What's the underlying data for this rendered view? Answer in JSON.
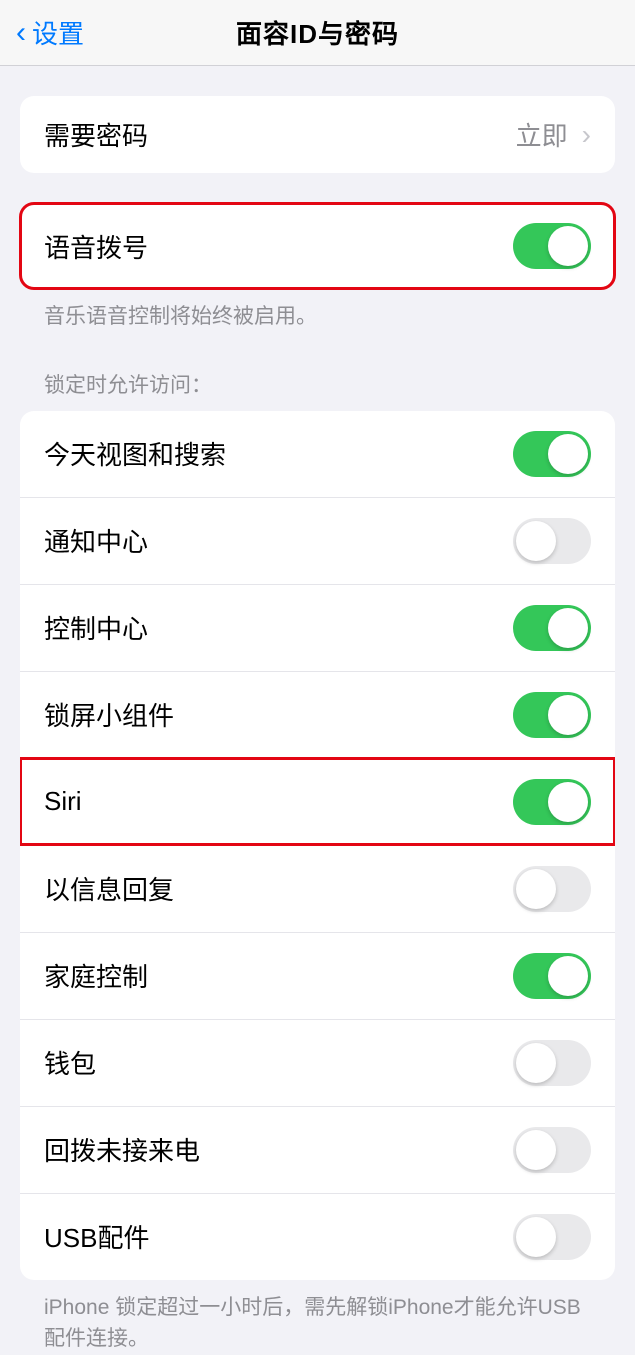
{
  "nav": {
    "back_label": "设置",
    "title": "面容ID与密码"
  },
  "require_passcode": {
    "label": "需要密码",
    "value": "立即"
  },
  "voice_dial": {
    "label": "语音拨号",
    "on": true,
    "footer": "音乐语音控制将始终被启用。"
  },
  "lock_access": {
    "header": "锁定时允许访问：",
    "items": [
      {
        "label": "今天视图和搜索",
        "on": true
      },
      {
        "label": "通知中心",
        "on": false
      },
      {
        "label": "控制中心",
        "on": true
      },
      {
        "label": "锁屏小组件",
        "on": true
      },
      {
        "label": "Siri",
        "on": true
      },
      {
        "label": "以信息回复",
        "on": false
      },
      {
        "label": "家庭控制",
        "on": true
      },
      {
        "label": "钱包",
        "on": false
      },
      {
        "label": "回拨未接来电",
        "on": false
      },
      {
        "label": "USB配件",
        "on": false
      }
    ],
    "footer": "iPhone 锁定超过一小时后，需先解锁iPhone才能允许USB配件连接。"
  }
}
